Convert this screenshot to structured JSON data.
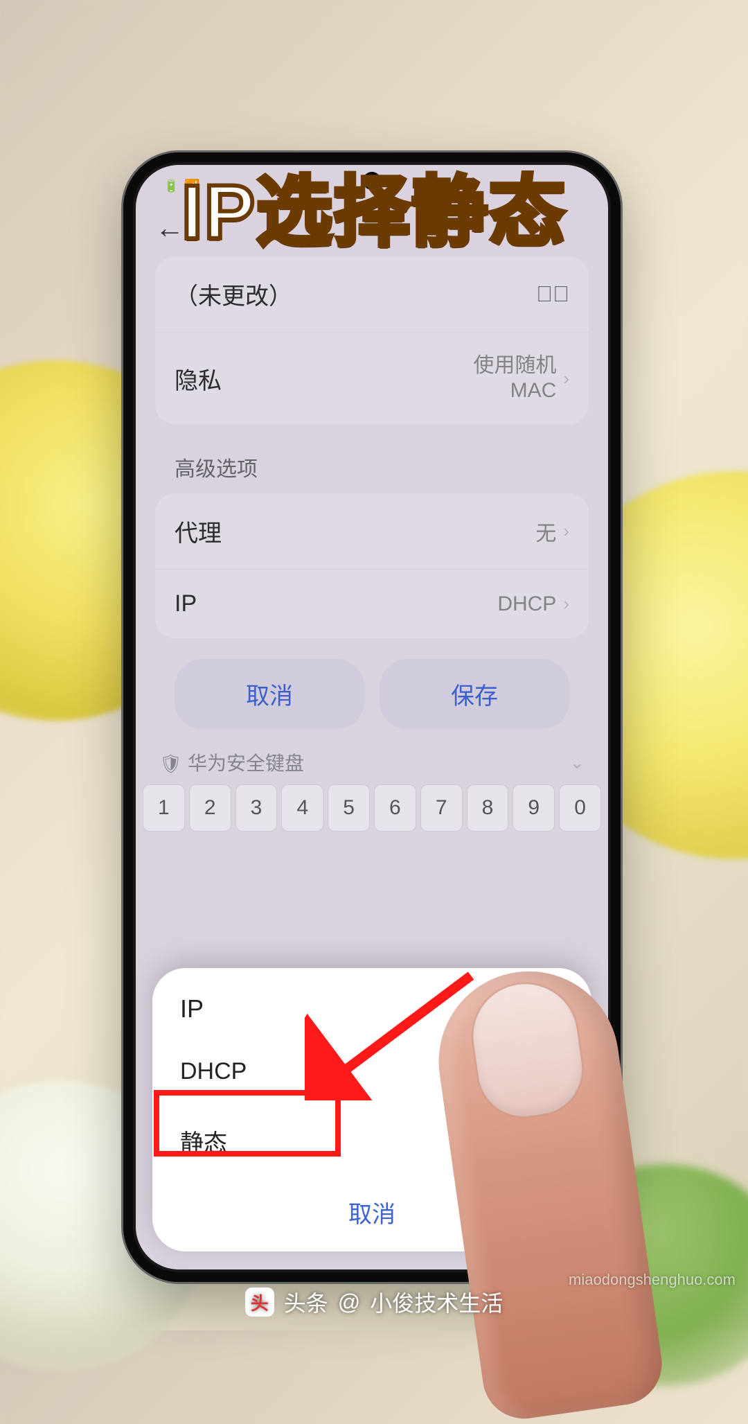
{
  "annotation": {
    "part1": "IP选择",
    "part2": "静态"
  },
  "status": {
    "left_icon": "🔋",
    "wifi_icon": "📶"
  },
  "header": {
    "title": ""
  },
  "password_row": {
    "value": "（未更改）"
  },
  "privacy": {
    "label": "隐私",
    "value_line1": "使用随机",
    "value_line2": "MAC"
  },
  "advanced": {
    "label": "高级选项"
  },
  "proxy": {
    "label": "代理",
    "value": "无"
  },
  "ip": {
    "label": "IP",
    "value": "DHCP"
  },
  "buttons": {
    "cancel": "取消",
    "save": "保存"
  },
  "keyboard": {
    "label": "华为安全键盘",
    "keys": [
      "1",
      "2",
      "3",
      "4",
      "5",
      "6",
      "7",
      "8",
      "9",
      "0"
    ]
  },
  "sheet": {
    "title": "IP",
    "options": [
      {
        "label": "DHCP",
        "selected": true
      },
      {
        "label": "静态",
        "selected": false
      }
    ],
    "cancel": "取消"
  },
  "footer": {
    "prefix": "头条",
    "at": "@",
    "author": "小俊技术生活"
  },
  "watermark": "miaodongshenghuo.com"
}
